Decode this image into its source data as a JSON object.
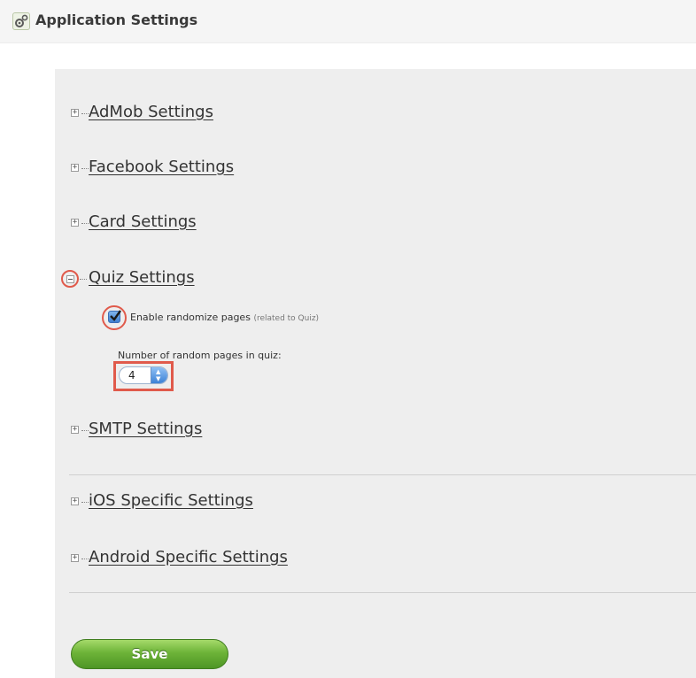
{
  "header": {
    "title": "Application Settings",
    "icon": "gear-icon"
  },
  "sections": [
    {
      "label": "AdMob Settings"
    },
    {
      "label": "Facebook Settings"
    },
    {
      "label": "Card Settings"
    },
    {
      "label": "Quiz Settings"
    },
    {
      "label": "SMTP Settings"
    },
    {
      "label": "iOS Specific Settings"
    },
    {
      "label": "Android Specific Settings"
    }
  ],
  "quiz": {
    "enable_label": "Enable randomize pages",
    "enable_note": "(related to Quiz)",
    "enable_checked": true,
    "pages_label": "Number of random pages in quiz:",
    "pages_value": "4"
  },
  "toggle_symbols": {
    "collapsed": "+",
    "expanded": "−"
  },
  "save_label": "Save",
  "colors": {
    "highlight": "#e05a4b",
    "save_button": "#6db338",
    "panel": "#eeeeee"
  }
}
